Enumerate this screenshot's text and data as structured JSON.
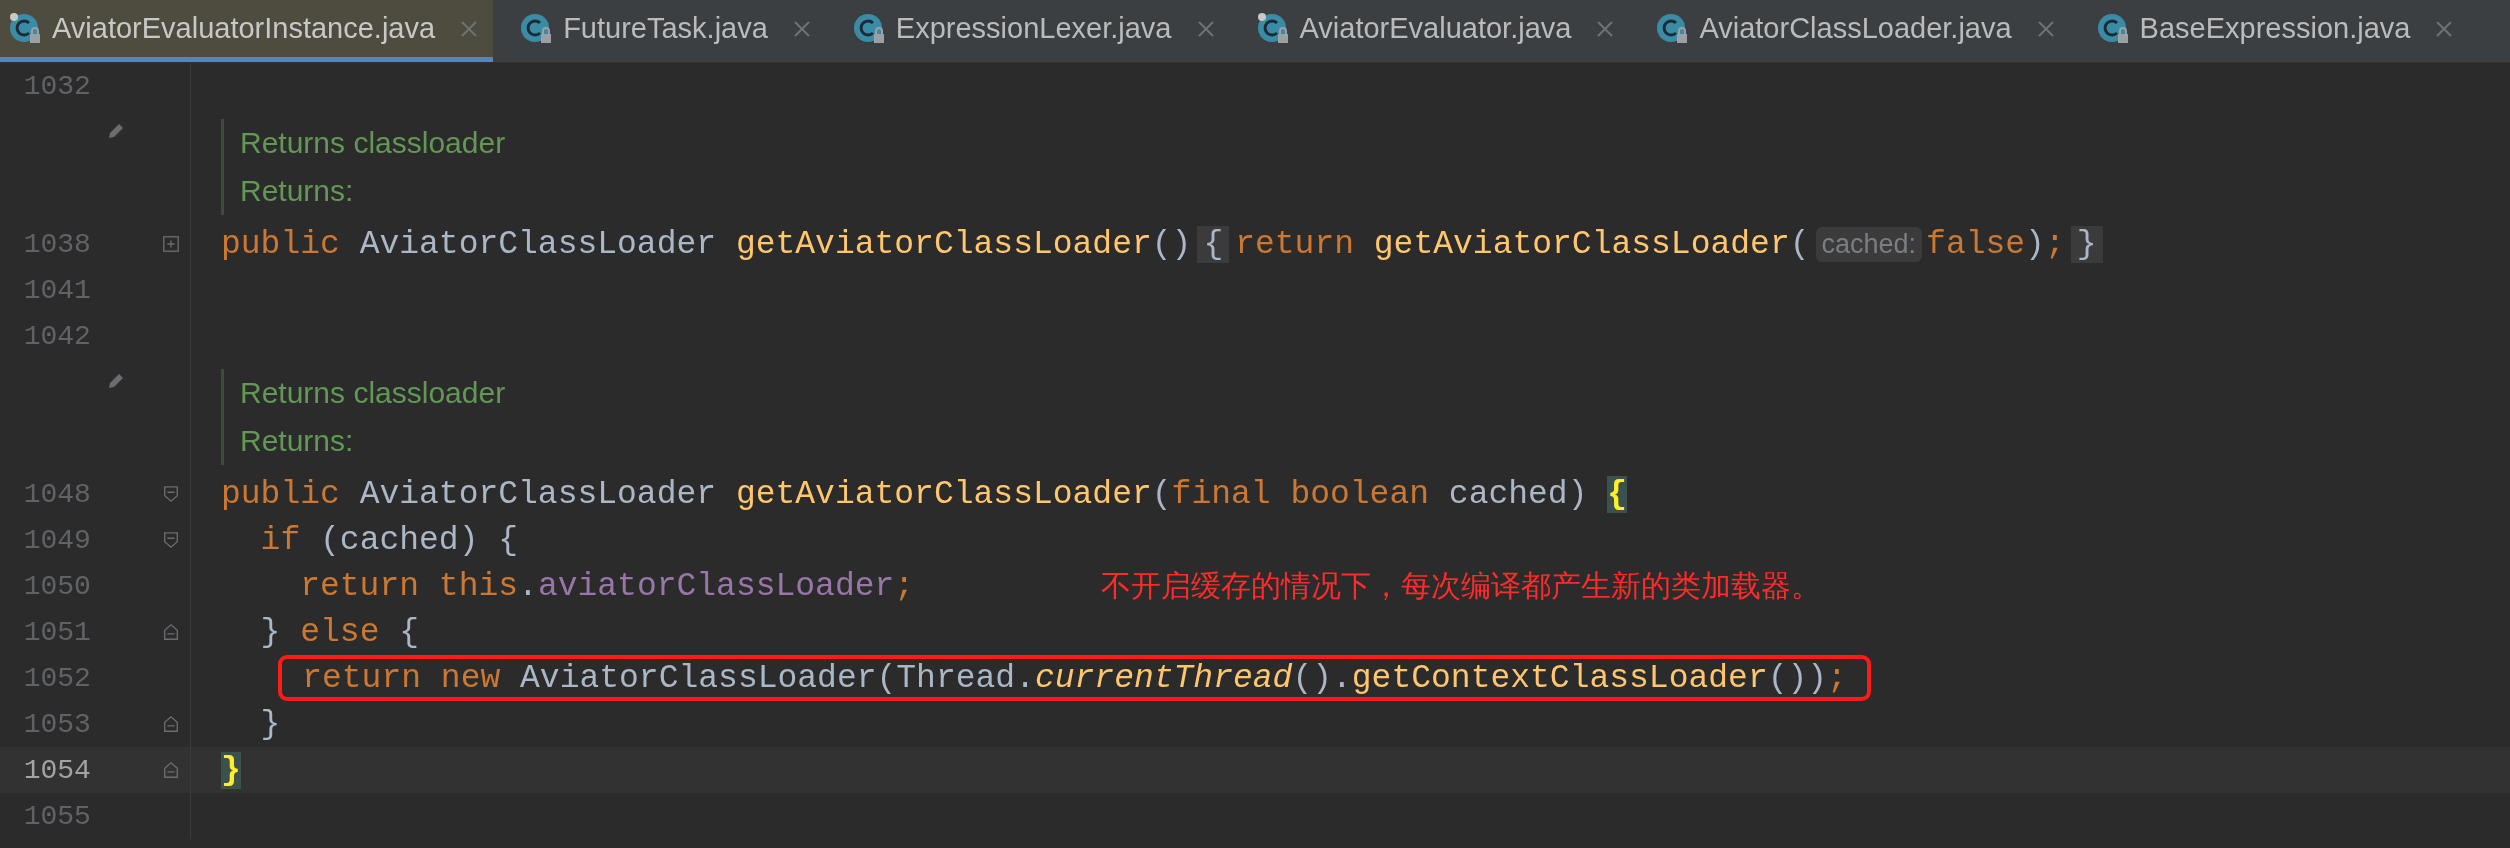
{
  "tabs": [
    {
      "label": "AviatorEvaluatorInstance.java",
      "selected": true,
      "badge": true
    },
    {
      "label": "FutureTask.java",
      "selected": false,
      "badge": false
    },
    {
      "label": "ExpressionLexer.java",
      "selected": false,
      "badge": false
    },
    {
      "label": "AviatorEvaluator.java",
      "selected": false,
      "badge": true
    },
    {
      "label": "AviatorClassLoader.java",
      "selected": false,
      "badge": false
    },
    {
      "label": "BaseExpression.java",
      "selected": false,
      "badge": false
    }
  ],
  "lines": [
    {
      "kind": "code",
      "number": "1032",
      "current": false
    },
    {
      "kind": "doc",
      "lines": [
        "Returns classloader",
        "Returns:"
      ]
    },
    {
      "kind": "code",
      "number": "1038",
      "current": false,
      "boxed": false,
      "fold_marker": {
        "kind": "collapsed"
      },
      "tokens": [
        {
          "kind": "kw",
          "t": "public "
        },
        {
          "kind": "plain",
          "t": "AviatorClassLoader "
        },
        {
          "kind": "fn",
          "t": "getAviatorClassLoader"
        },
        {
          "kind": "plain",
          "t": "()"
        },
        {
          "kind": "folded",
          "t": "{"
        },
        {
          "kind": "kw",
          "t": "return "
        },
        {
          "kind": "fn",
          "t": "getAviatorClassLoader"
        },
        {
          "kind": "plain",
          "t": "("
        },
        {
          "kind": "hint",
          "t": "cached:"
        },
        {
          "kind": "kw",
          "t": "false"
        },
        {
          "kind": "plain",
          "t": ")"
        },
        {
          "kind": "kw",
          "t": ";"
        },
        {
          "kind": "folded",
          "t": "}"
        }
      ]
    },
    {
      "kind": "code",
      "number": "1041",
      "current": false
    },
    {
      "kind": "code",
      "number": "1042",
      "current": false
    },
    {
      "kind": "doc",
      "lines": [
        "Returns classloader",
        "Returns:"
      ]
    },
    {
      "kind": "code",
      "number": "1048",
      "current": false,
      "boxed": false,
      "fold_marker": {
        "kind": "open"
      },
      "tokens": [
        {
          "kind": "kw",
          "t": "public "
        },
        {
          "kind": "plain",
          "t": "AviatorClassLoader "
        },
        {
          "kind": "fn",
          "t": "getAviatorClassLoader"
        },
        {
          "kind": "plain",
          "t": "("
        },
        {
          "kind": "kw",
          "t": "final boolean "
        },
        {
          "kind": "plain",
          "t": "cached) "
        },
        {
          "kind": "match",
          "t": "{"
        }
      ]
    },
    {
      "kind": "code",
      "number": "1049",
      "current": false,
      "boxed": false,
      "fold_marker": {
        "kind": "open"
      },
      "tokens": [
        {
          "kind": "kw",
          "t": "  if "
        },
        {
          "kind": "plain",
          "t": "(cached) {"
        }
      ]
    },
    {
      "kind": "code",
      "number": "1050",
      "current": false,
      "boxed": false,
      "tokens": [
        {
          "kind": "kw",
          "t": "    return this"
        },
        {
          "kind": "plain",
          "t": "."
        },
        {
          "kind": "field",
          "t": "aviatorClassLoader"
        },
        {
          "kind": "kw",
          "t": ";"
        }
      ],
      "note": "不开启缓存的情况下，每次编译都产生新的类加载器。"
    },
    {
      "kind": "code",
      "number": "1051",
      "current": false,
      "boxed": false,
      "fold_marker": {
        "kind": "end"
      },
      "tokens": [
        {
          "kind": "plain",
          "t": "  } "
        },
        {
          "kind": "kw",
          "t": "else "
        },
        {
          "kind": "plain",
          "t": "{"
        }
      ]
    },
    {
      "kind": "code",
      "number": "1052",
      "current": false,
      "boxed": true,
      "tokens": [
        {
          "kind": "kw",
          "t": "return new "
        },
        {
          "kind": "plain",
          "t": "AviatorClassLoader(Thread."
        },
        {
          "kind": "italic",
          "t": "currentThread"
        },
        {
          "kind": "plain",
          "t": "()."
        },
        {
          "kind": "fn",
          "t": "getContextClassLoader"
        },
        {
          "kind": "plain",
          "t": "())"
        },
        {
          "kind": "kw",
          "t": ";"
        }
      ]
    },
    {
      "kind": "code",
      "number": "1053",
      "current": false,
      "boxed": false,
      "fold_marker": {
        "kind": "end"
      },
      "tokens": [
        {
          "kind": "plain",
          "t": "  }"
        }
      ]
    },
    {
      "kind": "code",
      "number": "1054",
      "current": true,
      "boxed": false,
      "fold_marker": {
        "kind": "end"
      },
      "tokens": [
        {
          "kind": "match",
          "t": "}"
        }
      ]
    },
    {
      "kind": "code",
      "number": "1055",
      "current": false
    }
  ]
}
